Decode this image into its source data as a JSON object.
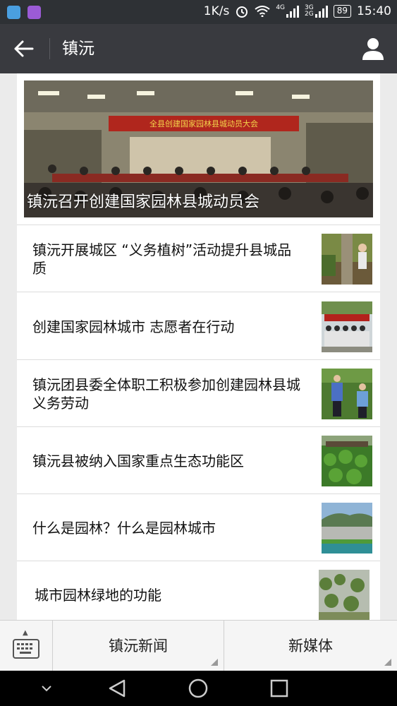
{
  "status_bar": {
    "speed": "1K/s",
    "net1": "4G",
    "net2a": "3G",
    "net2b": "2G",
    "battery": "89",
    "time": "15:40"
  },
  "title_bar": {
    "title": "镇沅",
    "back_icon": "arrow-left-icon",
    "profile_icon": "person-icon"
  },
  "hero": {
    "banner_text": "全县创建国家园林县城动员大会",
    "caption": "镇沅召开创建国家园林县城动员会"
  },
  "articles": [
    {
      "title": "镇沅开展城区 “义务植树”活动提升县城品质",
      "thumb": "tree-planting-photo"
    },
    {
      "title": "创建国家园林城市 志愿者在行动",
      "thumb": "volunteers-group-photo"
    },
    {
      "title": "镇沅团县委全体职工积极参加创建园林县城义务劳动",
      "thumb": "volunteer-labor-photo"
    },
    {
      "title": "镇沅县被纳入国家重点生态功能区",
      "thumb": "green-vegetation-photo"
    },
    {
      "title": "什么是园林？什么是园林城市",
      "thumb": "city-aerial-photo"
    },
    {
      "title": "城市园林绿地的功能",
      "thumb": "greenery-photo"
    }
  ],
  "bottom_menu": {
    "keyboard_icon": "keyboard-icon",
    "menu1": "镇沅新闻",
    "menu2": "新媒体"
  },
  "nav_bar": {
    "icons": [
      "chevron-down-icon",
      "back-triangle-icon",
      "home-circle-icon",
      "recents-square-icon"
    ]
  },
  "colors": {
    "status_bar": "#2e3135",
    "title_bar": "#393a3f",
    "background": "#ebebeb"
  }
}
